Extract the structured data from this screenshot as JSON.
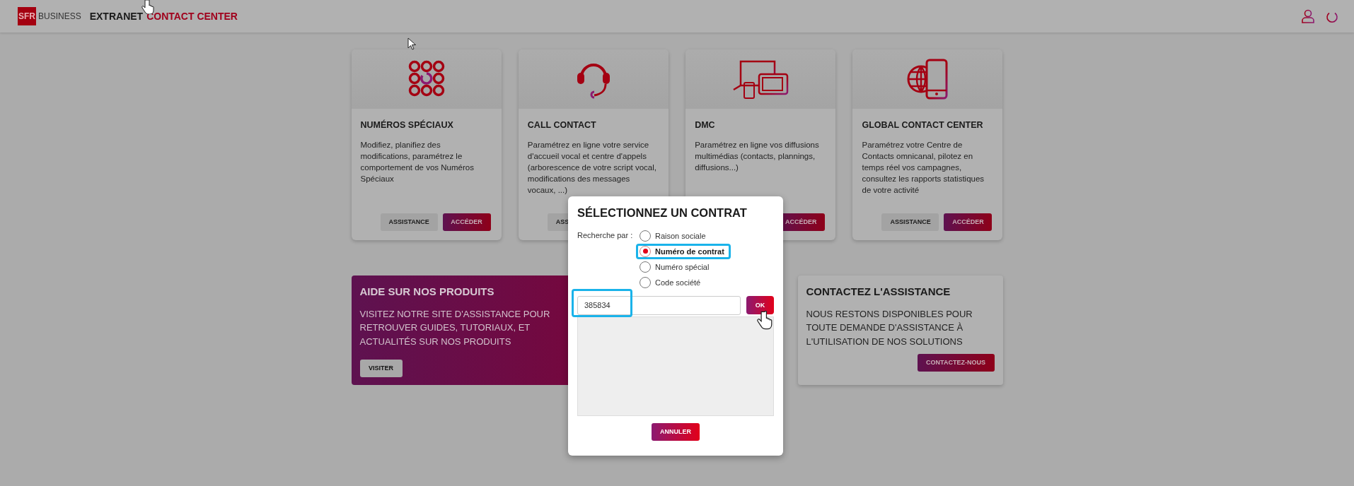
{
  "header": {
    "logo_badge": "SFR",
    "logo_text": "BUSINESS",
    "title": "EXTRANET",
    "title_accent": "CONTACT CENTER"
  },
  "products": [
    {
      "kind": "dialpad",
      "title": "NUMÉROS SPÉCIAUX",
      "description": "Modifiez, planifiez des modifications, paramétrez le comportement de vos Numéros Spéciaux",
      "buttons": [
        {
          "kind": "assistance",
          "label": "ASSISTANCE"
        },
        {
          "kind": "access",
          "label": "ACCÉDER"
        }
      ]
    },
    {
      "kind": "headset",
      "title": "CALL CONTACT",
      "description": "Paramétrez en ligne votre service d'accueil vocal et centre d'appels (arborescence de votre script vocal, modifications des messages vocaux, ...)",
      "buttons": [
        {
          "kind": "assistance",
          "label": "ASS"
        }
      ]
    },
    {
      "kind": "devices",
      "title": "DMC",
      "description": "Paramétrez en ligne vos diffusions multimédias (contacts, plannings, diffusions...)",
      "buttons": [
        {
          "kind": "access",
          "label": "ACCÉDER"
        }
      ]
    },
    {
      "kind": "globe",
      "title": "GLOBAL CONTACT CENTER",
      "description": "Paramétrez votre Centre de Contacts omnicanal, pilotez en temps réel vos campagnes, consultez les rapports statistiques de votre activité",
      "buttons": [
        {
          "kind": "assistance",
          "label": "ASSISTANCE"
        },
        {
          "kind": "access",
          "label": "ACCÉDER"
        }
      ]
    }
  ],
  "help_panel": {
    "title": "AIDE SUR NOS PRODUITS",
    "text": "VISITEZ NOTRE SITE D'ASSISTANCE POUR RETROUVER GUIDES, TUTORIAUX, ET ACTUALITÉS SUR NOS PRODUITS",
    "button": "VISITER"
  },
  "contact_panel": {
    "title": "CONTACTEZ L'ASSISTANCE",
    "text": "NOUS RESTONS DISPONIBLES POUR TOUTE DEMANDE D'ASSISTANCE À L'UTILISATION DE NOS SOLUTIONS",
    "button": "CONTACTEZ-NOUS"
  },
  "dialog": {
    "title": "SÉLECTIONNEZ UN CONTRAT",
    "search_label": "Recherche par :",
    "options": [
      {
        "label": "Raison sociale",
        "selected": false,
        "highlighted": false
      },
      {
        "label": "Numéro de contrat",
        "selected": true,
        "highlighted": true
      },
      {
        "label": "Numéro spécial",
        "selected": false,
        "highlighted": false
      },
      {
        "label": "Code société",
        "selected": false,
        "highlighted": false
      }
    ],
    "input": {
      "value": "385834",
      "highlighted": true
    },
    "ok_button": "OK",
    "cancel_button": "ANNULER"
  }
}
